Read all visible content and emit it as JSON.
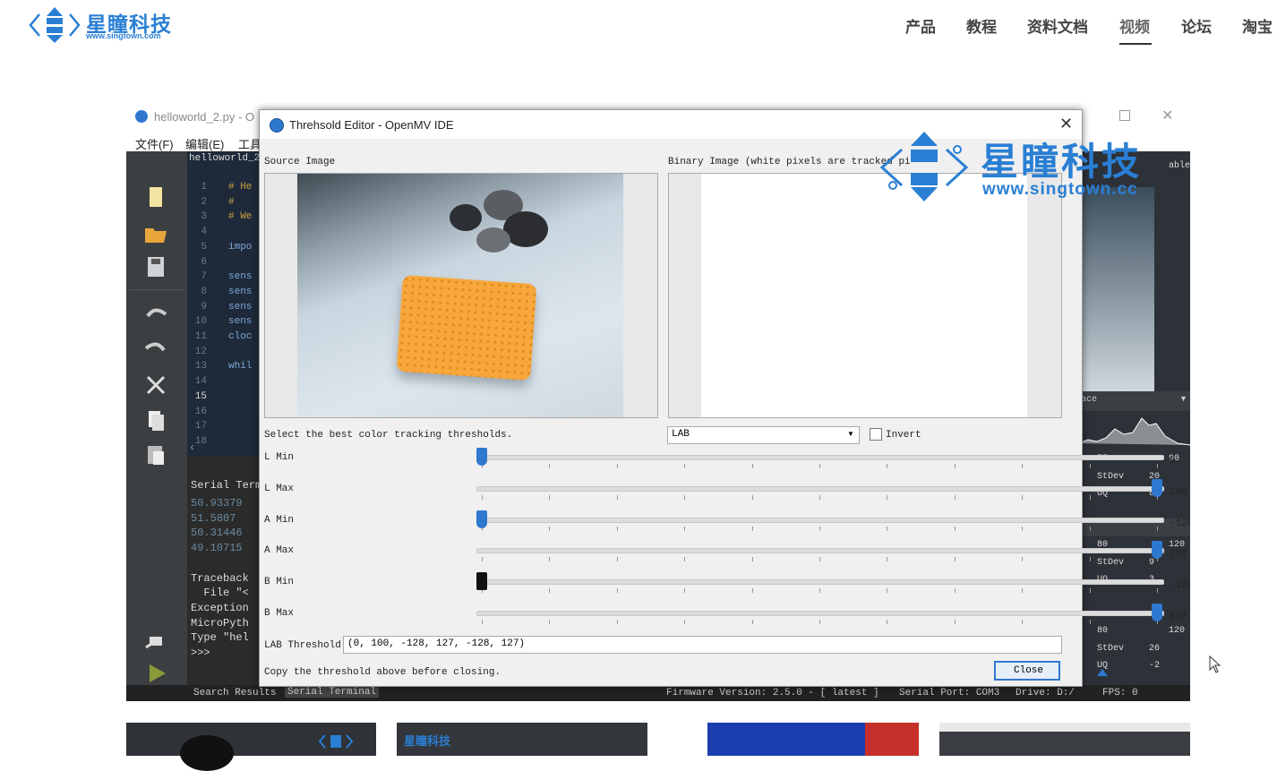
{
  "site": {
    "logo_title": "星瞳科技",
    "logo_sub": "www.singtown.com",
    "nav": [
      "产品",
      "教程",
      "资料文档",
      "视频",
      "论坛",
      "淘宝"
    ],
    "active_nav": "视频"
  },
  "ide": {
    "bg_window_title": "helloworld_2.py - O",
    "menu": [
      "文件(F)",
      "编辑(E)",
      "工具"
    ],
    "file_tab": "helloworld_2",
    "line_numbers": [
      "1",
      "2",
      "3",
      "4",
      "5",
      "6",
      "7",
      "8",
      "9",
      "10",
      "11",
      "12",
      "13",
      "14",
      "15",
      "16",
      "17",
      "18"
    ],
    "code_lines": [
      "# He",
      "#",
      "# We",
      "",
      "impo",
      "",
      "sens",
      "sens",
      "sens",
      "sens",
      "cloc",
      "",
      "whil",
      "",
      "",
      "",
      "",
      ""
    ],
    "serial_header": "Serial Termi",
    "serial_lines": [
      "50.93379",
      "51.5807",
      "50.31446",
      "49.10715",
      "",
      "Traceback",
      "  File \"<",
      "Exception",
      "MicroPyth",
      "Type \"hel",
      ">>>"
    ],
    "status": {
      "search_results": "Search Results",
      "serial_terminal": "Serial Terminal",
      "firmware": "Firmware Version: 2.5.0 - [ latest ]",
      "serial_port": "Serial Port: COM3",
      "drive": "Drive: D:/",
      "fps": "FPS: 0"
    },
    "right_panel": {
      "header_fragment": "able",
      "histogram_label": "ace",
      "stats": [
        {
          "cols": [
            "75",
            "90"
          ],
          "rows": [
            [
              "StDev",
              "20"
            ],
            [
              "UQ",
              "85"
            ]
          ]
        },
        {
          "cols": [
            "80",
            "120"
          ],
          "rows": [
            [
              "StDev",
              "9"
            ],
            [
              "UQ",
              "3"
            ]
          ]
        },
        {
          "cols": [
            "80",
            "120"
          ],
          "rows": [
            [
              "StDev",
              "26"
            ],
            [
              "UQ",
              "-2"
            ]
          ]
        }
      ]
    }
  },
  "dialog": {
    "title": "Threhsold Editor - OpenMV IDE",
    "source_label": "Source Image",
    "binary_label": "Binary Image (white pixels are tracked pi",
    "select_label": "Select the best color tracking thresholds.",
    "color_space": "LAB",
    "invert_label": "Invert",
    "sliders": [
      {
        "label": "L Min",
        "value": "0",
        "fraction": 0.0
      },
      {
        "label": "L Max",
        "value": "100",
        "fraction": 1.0
      },
      {
        "label": "A Min",
        "value": "-128",
        "fraction": 0.0
      },
      {
        "label": "A Max",
        "value": "127",
        "fraction": 1.0
      },
      {
        "label": "B Min",
        "value": "-128",
        "fraction": 0.0
      },
      {
        "label": "B Max",
        "value": "127",
        "fraction": 1.0
      }
    ],
    "threshold_label": "LAB Threshold",
    "threshold_value": "(0, 100, -128, 127, -128, 127)",
    "copy_note": "Copy the threshold above before closing.",
    "close_button": "Close"
  },
  "watermark": {
    "title": "星瞳科技",
    "sub": "www.singtown.cc"
  },
  "thumbnails": {
    "thumb2_text": "星瞳科技"
  },
  "colors": {
    "brand_blue": "#2a7fd4",
    "ide_dark": "#2b2b2b",
    "slider_thumb": "#2f78d0",
    "breadboard_orange": "#f7a73c"
  }
}
